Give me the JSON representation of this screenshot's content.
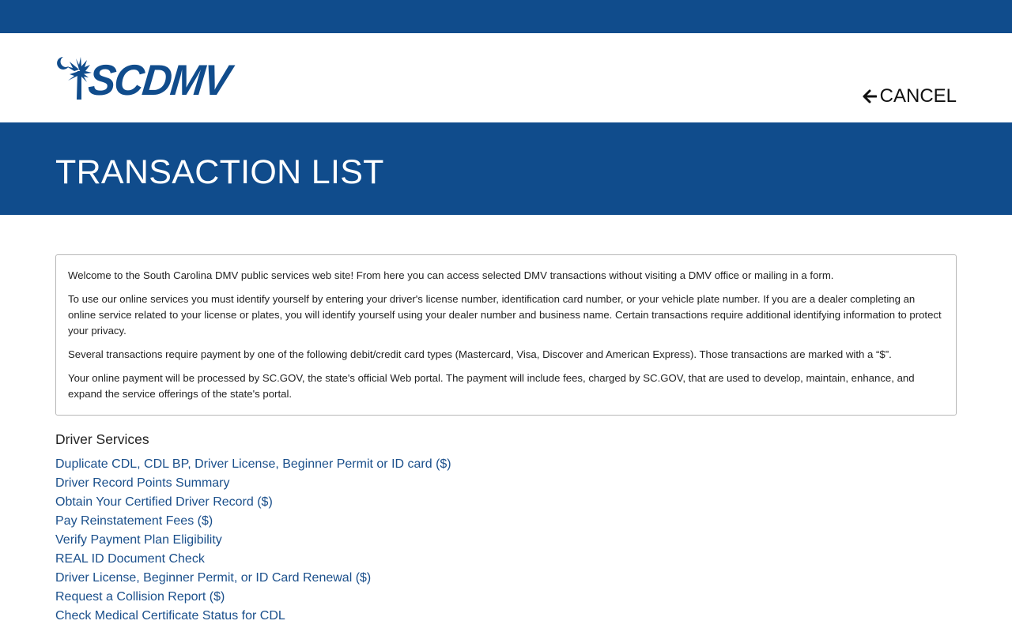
{
  "header": {
    "logo_text": "SCDMV",
    "cancel_label": "CANCEL"
  },
  "page": {
    "title": "TRANSACTION LIST"
  },
  "info": {
    "p1": "Welcome to the South Carolina DMV public services web site! From here you can access selected DMV transactions without visiting a DMV office or mailing in a form.",
    "p2": "To use our online services you must identify yourself by entering your driver's license number, identification card number, or your vehicle plate number. If you are a dealer completing an online service related to your license or plates, you will identify yourself using your dealer number and business name. Certain transactions require additional identifying information to protect your privacy.",
    "p3": "Several transactions require payment by one of the following debit/credit card types (Mastercard, Visa, Discover and American Express). Those transactions are marked with a “$”.",
    "p4": "Your online payment will be processed by SC.GOV, the state's official Web portal. The payment will include fees, charged by SC.GOV, that are used to develop, maintain, enhance, and expand the service offerings of the state's portal."
  },
  "driver_services": {
    "heading": "Driver Services",
    "links": [
      "Duplicate CDL, CDL BP, Driver License, Beginner Permit or ID card ($)",
      "Driver Record Points Summary",
      "Obtain Your Certified Driver Record ($)",
      "Pay Reinstatement Fees ($)",
      "Verify Payment Plan Eligibility",
      "REAL ID Document Check",
      "Driver License, Beginner Permit, or ID Card Renewal ($)",
      "Request a Collision Report ($)",
      "Check Medical Certificate Status for CDL"
    ]
  },
  "colors": {
    "brand_blue": "#104c8c",
    "link_blue": "#1a4f8b"
  },
  "icons": {
    "logo": "palmetto-moon-icon",
    "cancel": "arrow-left-icon"
  }
}
